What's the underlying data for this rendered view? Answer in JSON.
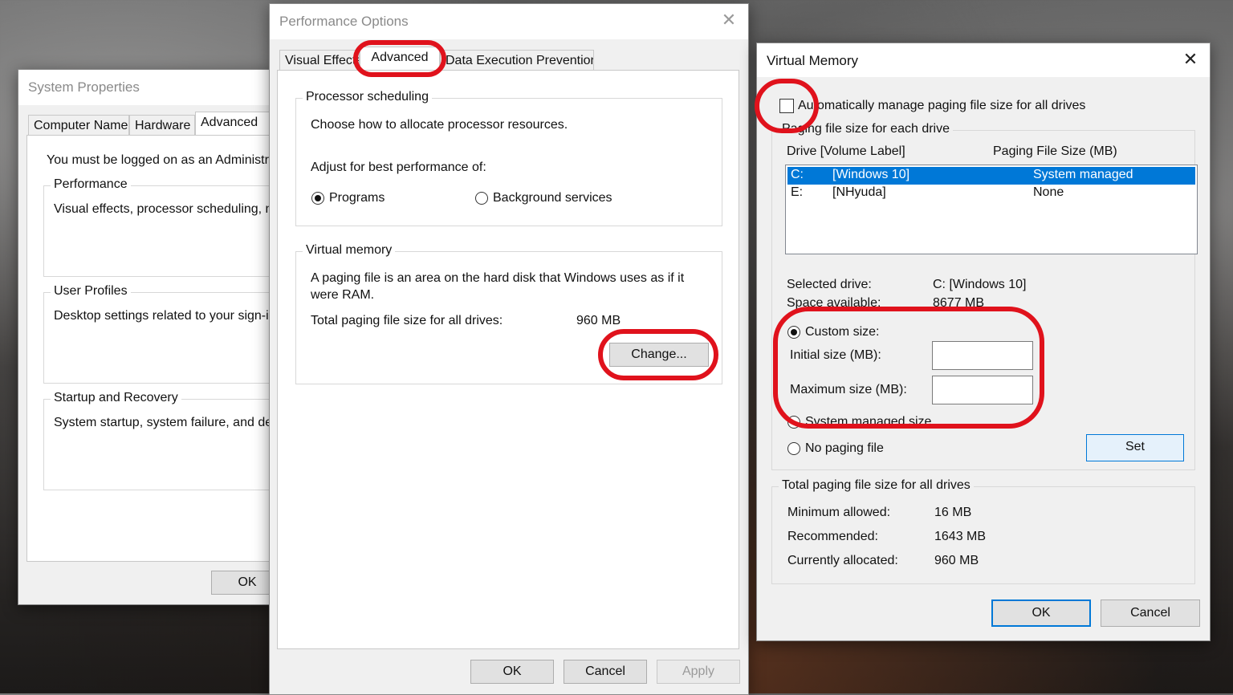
{
  "system_properties": {
    "title": "System Properties",
    "tabs": [
      "Computer Name",
      "Hardware",
      "Advanced"
    ],
    "admin_notice": "You must be logged on as an Administrato",
    "performance": {
      "legend": "Performance",
      "desc": "Visual effects, processor scheduling, me"
    },
    "user_profiles": {
      "legend": "User Profiles",
      "desc": "Desktop settings related to your sign-in"
    },
    "startup": {
      "legend": "Startup and Recovery",
      "desc": "System startup, system failure, and debu"
    },
    "ok_label": "OK"
  },
  "performance_options": {
    "title": "Performance Options",
    "tabs": [
      "Visual Effects",
      "Advanced",
      "Data Execution Prevention"
    ],
    "processor_scheduling": {
      "legend": "Processor scheduling",
      "desc": "Choose how to allocate processor resources.",
      "adjust_label": "Adjust for best performance of:",
      "option_programs": "Programs",
      "option_background": "Background services",
      "selected": "Programs"
    },
    "virtual_memory": {
      "legend": "Virtual memory",
      "desc_line1": "A paging file is an area on the hard disk that Windows uses as if it",
      "desc_line2": "were RAM.",
      "total_label": "Total paging file size for all drives:",
      "total_value": "960 MB",
      "change_label": "Change..."
    },
    "buttons": {
      "ok": "OK",
      "cancel": "Cancel",
      "apply": "Apply"
    }
  },
  "virtual_memory": {
    "title": "Virtual Memory",
    "auto_manage_label": "Automatically manage paging file size for all drives",
    "auto_manage_checked": false,
    "each_drive_legend": "Paging file size for each drive",
    "col_drive": "Drive  [Volume Label]",
    "col_size": "Paging File Size (MB)",
    "drives": [
      {
        "drive": "C:",
        "label": "[Windows 10]",
        "size": "System managed",
        "selected": true
      },
      {
        "drive": "E:",
        "label": "[NHyuda]",
        "size": "None",
        "selected": false
      }
    ],
    "selected_drive_label": "Selected drive:",
    "selected_drive_value": "C:  [Windows 10]",
    "space_available_label": "Space available:",
    "space_available_value": "8677 MB",
    "custom_size_label": "Custom size:",
    "initial_size_label": "Initial size (MB):",
    "initial_size_value": "",
    "maximum_size_label": "Maximum size (MB):",
    "maximum_size_value": "",
    "system_managed_label": "System managed size",
    "no_paging_label": "No paging file",
    "size_mode": "custom",
    "set_label": "Set",
    "totals_legend": "Total paging file size for all drives",
    "min_label": "Minimum allowed:",
    "min_value": "16 MB",
    "rec_label": "Recommended:",
    "rec_value": "1643 MB",
    "alloc_label": "Currently allocated:",
    "alloc_value": "960 MB",
    "ok_label": "OK",
    "cancel_label": "Cancel"
  },
  "colors": {
    "highlight": "#e0121c",
    "selection": "#0078d7"
  }
}
